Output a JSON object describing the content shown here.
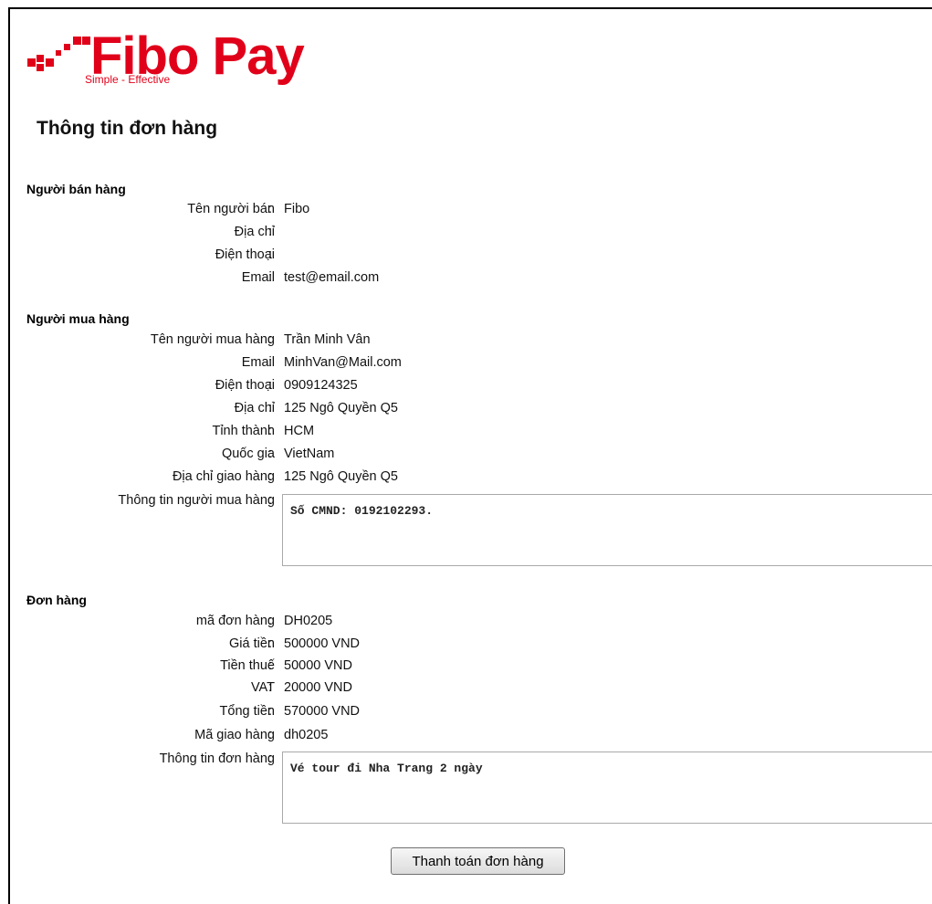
{
  "brand": {
    "name": "Fibo Pay",
    "tagline": "Simple - Effective",
    "color": "#e1001a"
  },
  "page_title": "Thông tin đơn hàng",
  "seller": {
    "title": "Người bán hàng",
    "rows": [
      {
        "label": "Tên người bán",
        "value": "Fibo"
      },
      {
        "label": "Địa chỉ",
        "value": ""
      },
      {
        "label": "Điện thoại",
        "value": ""
      },
      {
        "label": "Email",
        "value": "test@email.com"
      }
    ]
  },
  "buyer": {
    "title": "Người mua hàng",
    "rows": [
      {
        "label": "Tên người mua hàng",
        "value": "Trần Minh Vân"
      },
      {
        "label": "Email",
        "value": "MinhVan@Mail.com"
      },
      {
        "label": "Điện thoại",
        "value": "0909124325"
      },
      {
        "label": "Địa chỉ",
        "value": "125 Ngô Quyền Q5"
      },
      {
        "label": "Tỉnh thành",
        "value": "HCM"
      },
      {
        "label": "Quốc gia",
        "value": "VietNam"
      },
      {
        "label": "Địa chỉ giao hàng",
        "value": "125 Ngô Quyền Q5"
      }
    ],
    "info_label": "Thông tin người mua hàng",
    "info_value": "Số CMND: 0192102293."
  },
  "order": {
    "title": "Đơn hàng",
    "rows": [
      {
        "label": "mã đơn hàng",
        "value": "DH0205"
      },
      {
        "label": "Giá tiền",
        "value": "500000 VND"
      },
      {
        "label": "Tiền thuế",
        "value": "50000 VND"
      },
      {
        "label": "VAT",
        "value": "20000 VND"
      },
      {
        "label": "Tổng tiền",
        "value": "570000 VND"
      },
      {
        "label": "Mã giao hàng",
        "value": "dh0205"
      }
    ],
    "info_label": "Thông tin đơn hàng",
    "info_value": "Vé tour đi Nha Trang 2 ngày"
  },
  "colon": ":",
  "pay_button": "Thanh toán đơn hàng"
}
